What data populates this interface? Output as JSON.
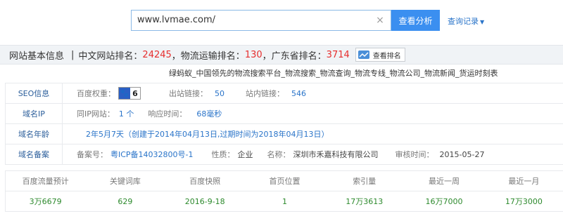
{
  "search": {
    "value": "www.lvmae.com/",
    "clear_icon": "×",
    "button": "查看分析",
    "history": "查询记录"
  },
  "header": {
    "title": "网站基本信息",
    "sep": "|",
    "ranks": [
      {
        "label": "中文网站排名：",
        "value": "24245"
      },
      {
        "label": "物流运输排名：",
        "value": "130"
      },
      {
        "label": "广东省排名：",
        "value": "3714"
      }
    ],
    "rank_button": "查看排名"
  },
  "tagline": "绿蚂蚁_中国领先的物流搜索平台_物流搜索_物流查询_物流专线_物流公司_物流新闻_货运时刻表",
  "seo": {
    "label": "SEO信息",
    "baidu_weight_label": "百度权重：",
    "baidu_weight": "6",
    "outbound_label": "出站链接：",
    "outbound": "50",
    "inbound_label": "站内链接：",
    "inbound": "546"
  },
  "ip": {
    "label": "域名IP",
    "same_ip_label": "同IP网站：",
    "same_ip": "1 个",
    "response_label": "响应时间：",
    "response": "68毫秒"
  },
  "age": {
    "label": "域名年龄",
    "value": "2年5月7天（创建于2014年04月13日,过期时间为2018年04月13日）"
  },
  "record": {
    "label": "域名备案",
    "no_label": "备案号：",
    "no": "粤ICP备14032800号-1",
    "nature_label": "性质：",
    "nature": "企业",
    "name_label": "名称：",
    "name": "深圳市禾嘉科技有限公司",
    "date_label": "审核时间：",
    "date": "2015-05-27"
  },
  "stats": {
    "headers": [
      "百度流量预计",
      "关键词库",
      "百度快照",
      "首页位置",
      "索引量",
      "最近一周",
      "最近一月"
    ],
    "values": [
      "3万6679",
      "629",
      "2016-9-18",
      "1",
      "17万3613",
      "16万7000",
      "17万3000"
    ]
  }
}
